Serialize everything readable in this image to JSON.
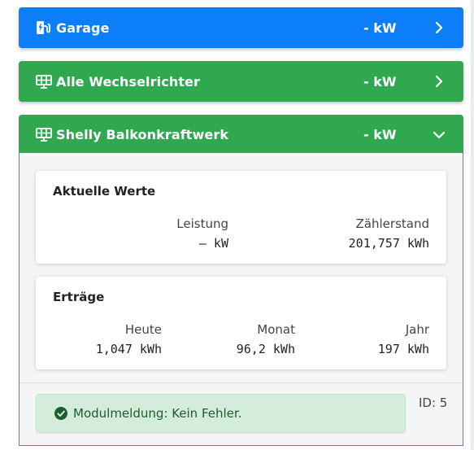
{
  "colors": {
    "blue": "#0d7ef9",
    "green": "#2fa84f",
    "alert_bg": "#d4edda"
  },
  "rows": [
    {
      "icon": "ev-charger-icon",
      "title": "Garage",
      "power": "- kW",
      "chevron": "chevron-right-icon"
    },
    {
      "icon": "solar-panel-icon",
      "title": "Alle Wechselrichter",
      "power": "- kW",
      "chevron": "chevron-right-icon"
    },
    {
      "icon": "solar-panel-icon",
      "title": "Shelly Balkonkraftwerk",
      "power": "- kW",
      "chevron": "chevron-down-icon"
    }
  ],
  "current": {
    "title": "Aktuelle Werte",
    "power_label": "Leistung",
    "power_value": "– kW",
    "meter_label": "Zählerstand",
    "meter_value": "201,757 kWh"
  },
  "yields": {
    "title": "Erträge",
    "today_label": "Heute",
    "today_value": "1,047 kWh",
    "month_label": "Monat",
    "month_value": "96,2 kWh",
    "year_label": "Jahr",
    "year_value": "197 kWh"
  },
  "status": {
    "message": "Modulmeldung: Kein Fehler.",
    "id": "ID: 5"
  }
}
